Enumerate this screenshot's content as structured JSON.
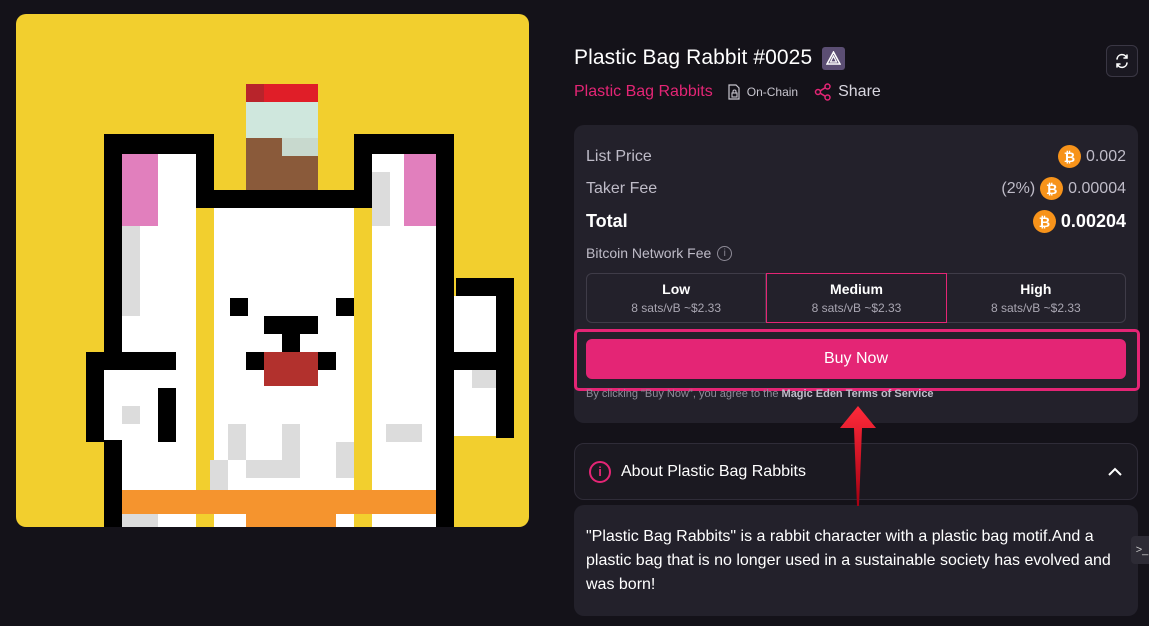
{
  "nft": {
    "title": "Plastic Bag Rabbit #0025",
    "collection": "Plastic Bag Rabbits",
    "onchain_label": "On-Chain",
    "share_label": "Share",
    "image_bg": "#f2cf2e"
  },
  "icons": {
    "chain_badge": "ordinals-triangle-icon",
    "refresh": "refresh-icon",
    "onchain": "document-lock-icon",
    "share": "share-icon",
    "currency": "bitcoin-icon",
    "info": "info-icon",
    "chevron": "chevron-up-icon"
  },
  "pricing": {
    "list_price_label": "List Price",
    "list_price_value": "0.002",
    "taker_fee_label": "Taker Fee",
    "taker_fee_pct": "(2%)",
    "taker_fee_value": "0.00004",
    "total_label": "Total",
    "total_value": "0.00204",
    "btc_symbol": "₿"
  },
  "network_fee": {
    "label": "Bitcoin Network Fee",
    "info_symbol": "i",
    "options": [
      {
        "name": "Low",
        "detail": "8 sats/vB ~$2.33",
        "selected": false
      },
      {
        "name": "Medium",
        "detail": "8 sats/vB ~$2.33",
        "selected": true
      },
      {
        "name": "High",
        "detail": "8 sats/vB ~$2.33",
        "selected": false
      }
    ]
  },
  "buy": {
    "button_label": "Buy Now",
    "terms_prefix": "By clicking \"Buy Now\", you agree to the",
    "terms_link": "Magic Eden Terms of Service"
  },
  "about": {
    "info_symbol": "i",
    "title": "About Plastic Bag Rabbits",
    "description": "\"Plastic Bag Rabbits\" is a rabbit character with a plastic bag motif.And a plastic bag that is no longer used in a sustainable society has evolved and was born!"
  },
  "side_tab": {
    "label": ">_"
  },
  "colors": {
    "accent": "#e42575",
    "background": "#141219",
    "panel": "#23212b",
    "bitcoin": "#f7931a",
    "annotation_arrow": "#d10a1f"
  }
}
